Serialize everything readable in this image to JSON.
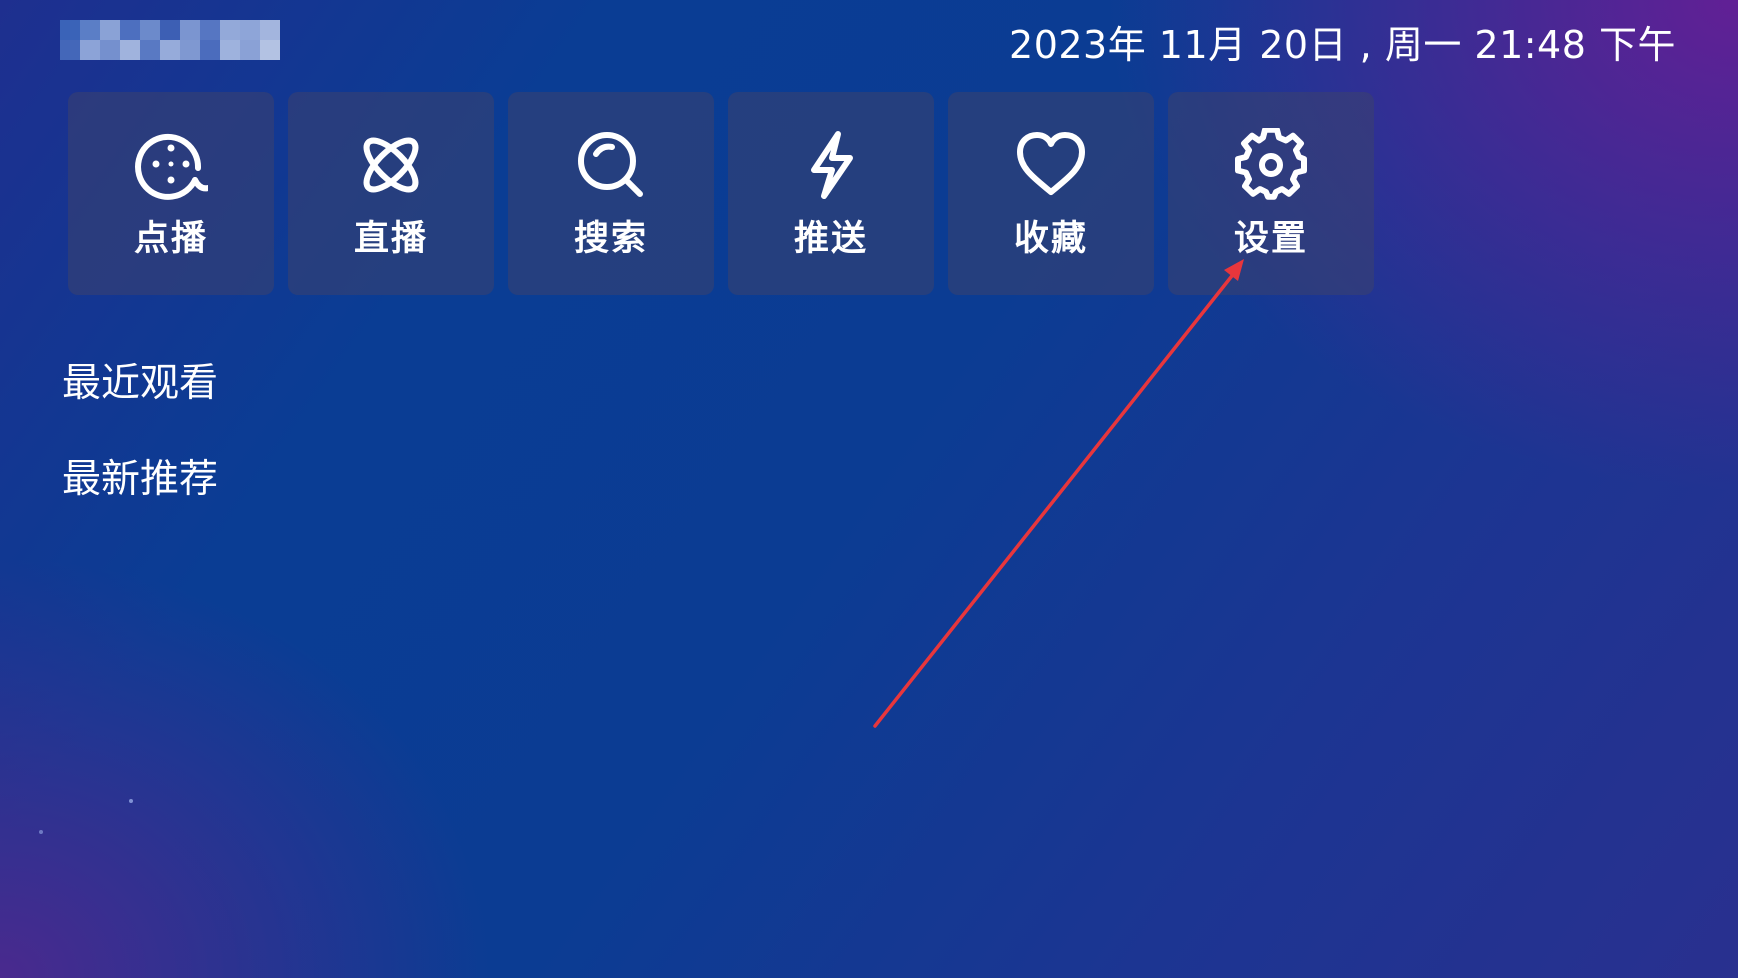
{
  "header": {
    "datetime": "2023年 11月 20日 , 周一 21:48 下午"
  },
  "menu": {
    "items": [
      {
        "label": "点播",
        "icon": "film-reel-icon"
      },
      {
        "label": "直播",
        "icon": "atom-icon"
      },
      {
        "label": "搜索",
        "icon": "search-icon"
      },
      {
        "label": "推送",
        "icon": "lightning-icon"
      },
      {
        "label": "收藏",
        "icon": "heart-icon"
      },
      {
        "label": "设置",
        "icon": "gear-icon"
      }
    ]
  },
  "sections": {
    "recent": "最近观看",
    "recommend": "最新推荐"
  },
  "colors": {
    "annotation_arrow": "#e8363c",
    "tile_bg": "#3c426e"
  }
}
